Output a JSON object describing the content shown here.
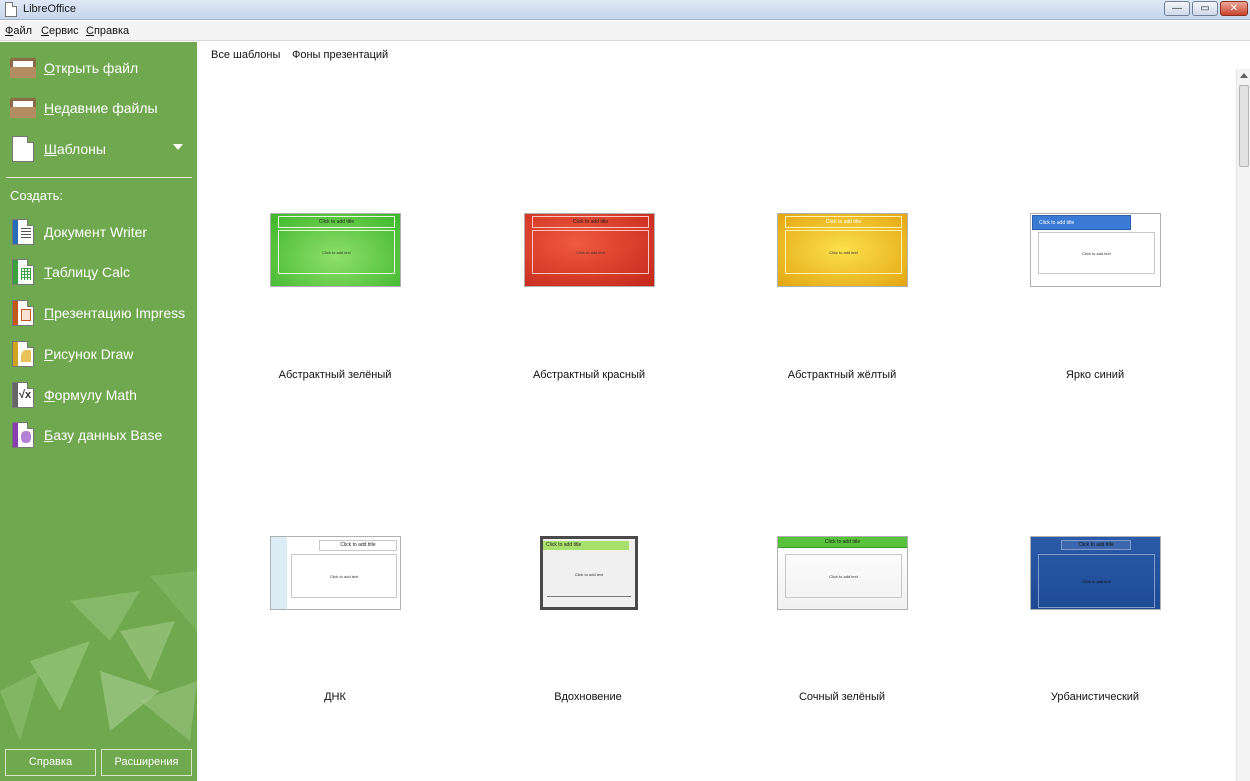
{
  "window": {
    "title": "LibreOffice",
    "controls": {
      "minimize": "—",
      "maximize": "▭",
      "close": "✕"
    }
  },
  "menu": {
    "items": [
      "Файл",
      "Сервис",
      "Справка"
    ]
  },
  "sidebar": {
    "open_file": "Открыть файл",
    "recent_files": "Недавние файлы",
    "templates": "Шаблоны",
    "create_heading": "Создать:",
    "create_items": [
      "Документ Writer",
      "Таблицу Calc",
      "Презентацию Impress",
      "Рисунок Draw",
      "Формулу Math",
      "Базу данных Base"
    ],
    "help_button": "Справка",
    "extensions_button": "Расширения",
    "colors": {
      "background": "#6fa84f",
      "writer": "#2a6db5",
      "calc": "#3aa13e",
      "impress": "#c4581b",
      "draw": "#d1a21d",
      "math": "#666666",
      "base": "#8a3fb0"
    }
  },
  "filter_tabs": [
    "Все шаблоны",
    "Фоны презентаций"
  ],
  "templates": [
    {
      "name": "Абстрактный зелёный",
      "title_text": "Click to add title",
      "body_text": "Click to add text"
    },
    {
      "name": "Абстрактный красный",
      "title_text": "Click to add title",
      "body_text": "Click to add text"
    },
    {
      "name": "Абстрактный жёлтый",
      "title_text": "Click to add title",
      "body_text": "Click to add text"
    },
    {
      "name": "Ярко синий",
      "title_text": "Click to add title",
      "body_text": "Click to add text"
    },
    {
      "name": "ДНК",
      "title_text": "Click to add title",
      "body_text": "Click to add text"
    },
    {
      "name": "Вдохновение",
      "title_text": "Click to add title",
      "body_text": "Click to add text"
    },
    {
      "name": "Сочный зелёный",
      "title_text": "Click to add title",
      "body_text": "Click to add text"
    },
    {
      "name": "Урбанистический",
      "title_text": "Click to add title",
      "body_text": "Click to add text"
    }
  ]
}
